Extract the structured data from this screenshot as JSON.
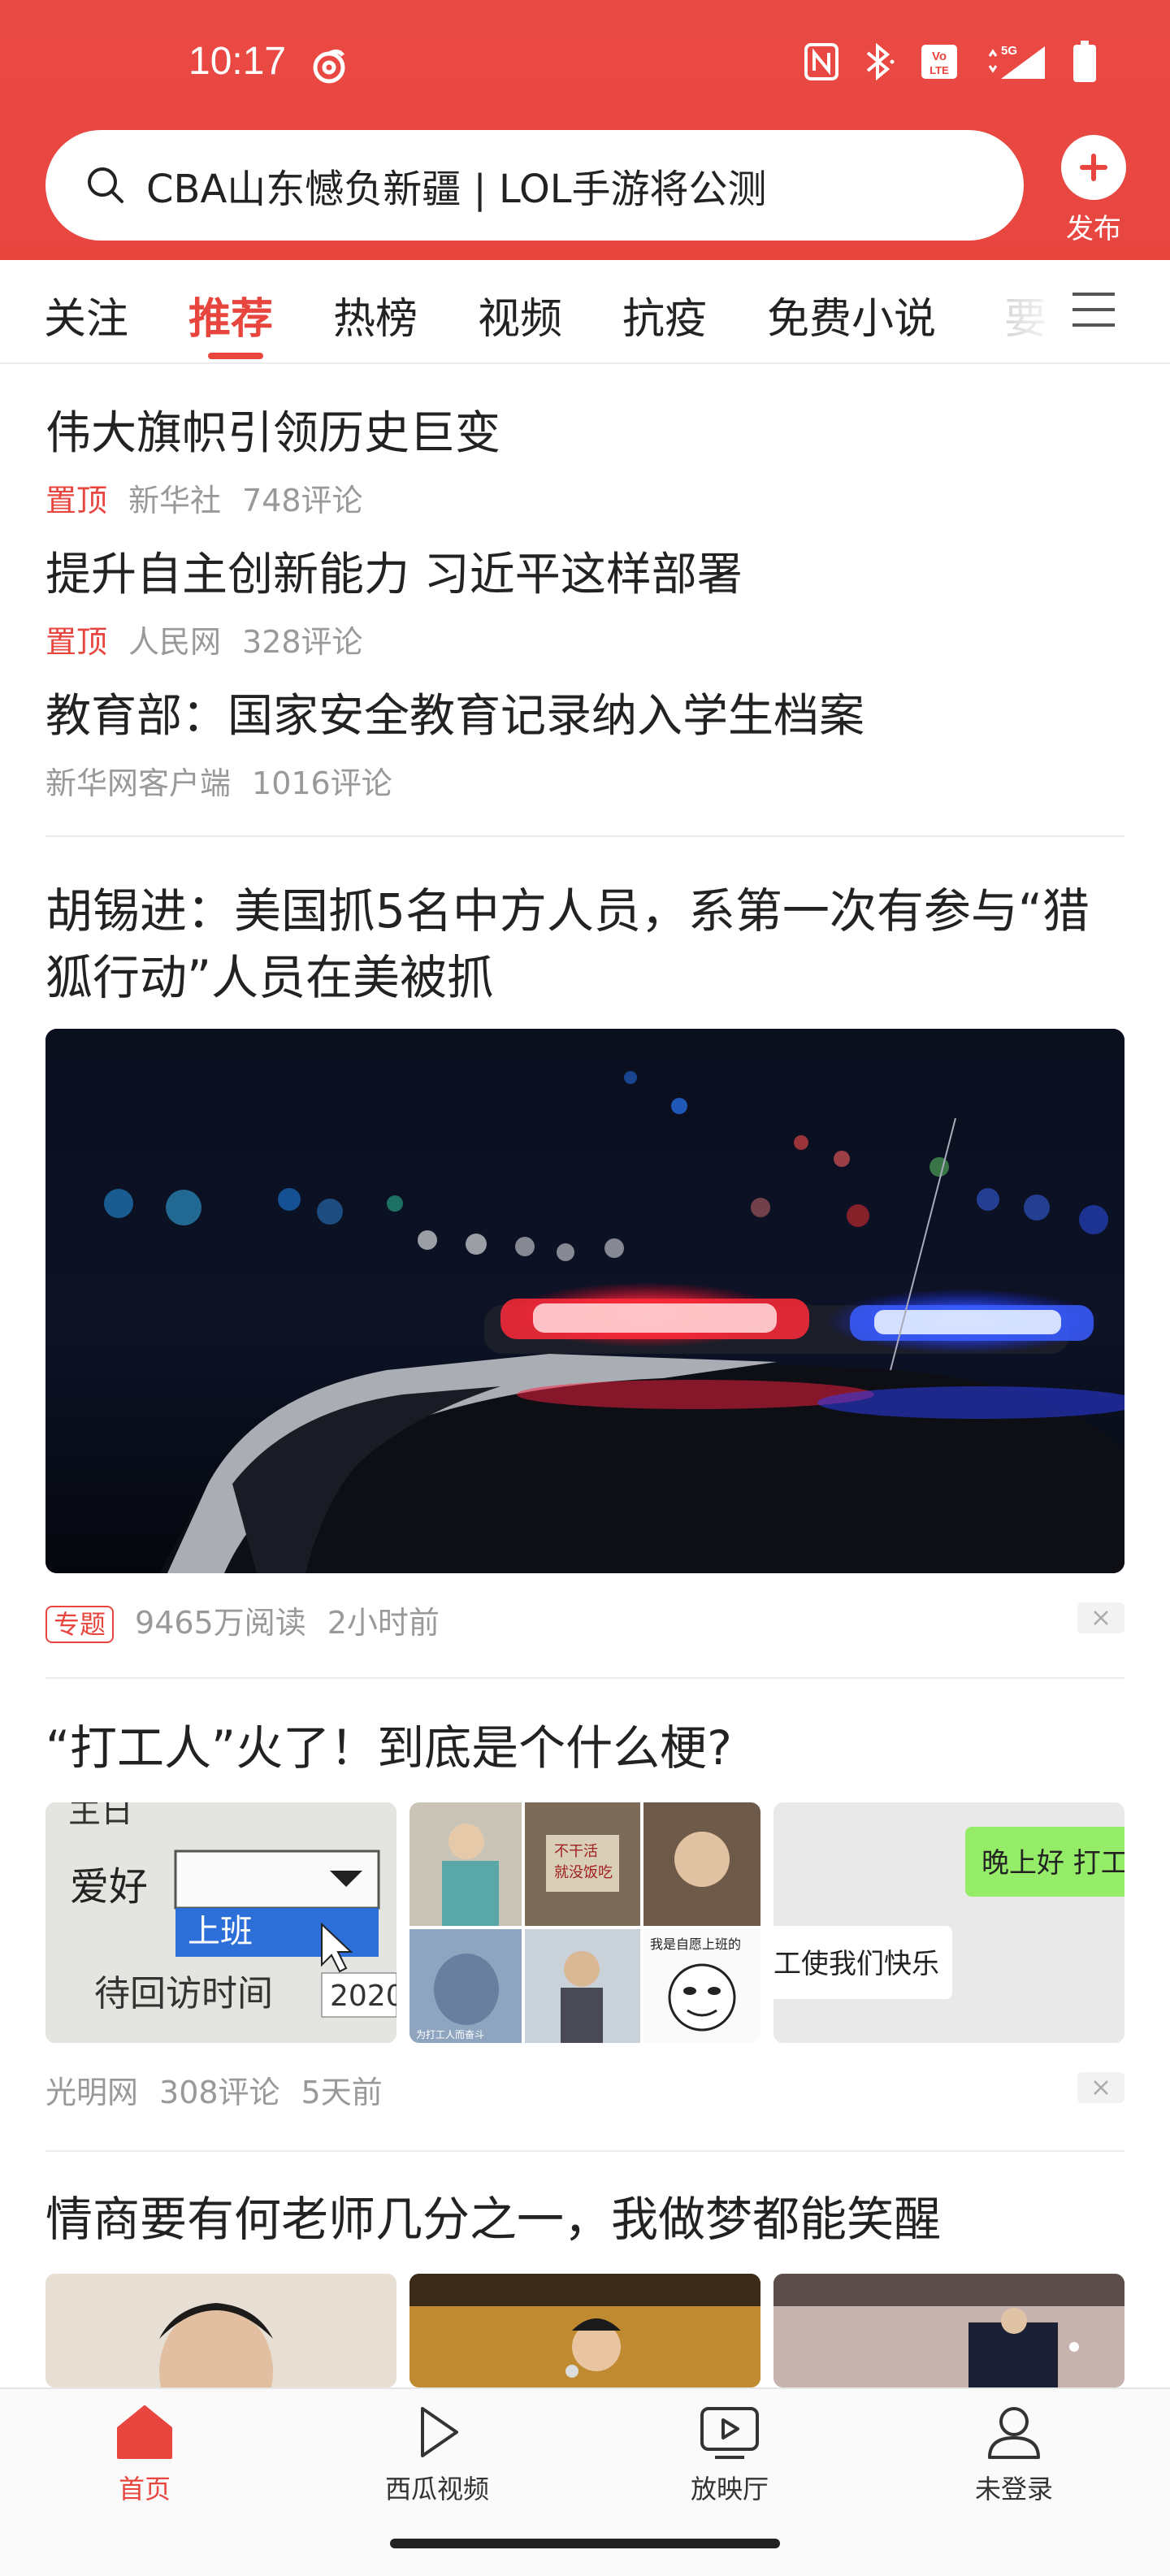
{
  "status_bar": {
    "time": "10:17",
    "icons": [
      "nfc-icon",
      "bluetooth-icon",
      "volte-icon",
      "5g-signal-icon",
      "battery-icon"
    ]
  },
  "search": {
    "placeholder": "CBA山东憾负新疆 | LOL手游将公测"
  },
  "publish": {
    "label": "发布"
  },
  "tabs": [
    {
      "label": "关注",
      "active": false
    },
    {
      "label": "推荐",
      "active": true
    },
    {
      "label": "热榜",
      "active": false
    },
    {
      "label": "视频",
      "active": false
    },
    {
      "label": "抗疫",
      "active": false
    },
    {
      "label": "免费小说",
      "active": false
    },
    {
      "label": "要",
      "active": false
    }
  ],
  "pinned": [
    {
      "title": "伟大旗帜引领历史巨变",
      "tag": "置顶",
      "source": "新华社",
      "comments": "748评论"
    },
    {
      "title": "提升自主创新能力 习近平这样部署",
      "tag": "置顶",
      "source": "人民网",
      "comments": "328评论"
    },
    {
      "title": "教育部：国家安全教育记录纳入学生档案",
      "tag": "",
      "source": "新华网客户端",
      "comments": "1016评论"
    }
  ],
  "article1": {
    "title_line1": "胡锡进：美国抓5名中方人员，系第一次有参与“猎",
    "title_line2": "狐行动”人员在美被抓",
    "badge": "专题",
    "reads": "9465万阅读",
    "time": "2小时前"
  },
  "article2": {
    "title": "“打工人”火了！到底是个什么梗?",
    "source": "光明网",
    "comments": "308评论",
    "time": "5天前",
    "thumb1_text": [
      "主日",
      "爱好",
      "上班",
      "待回访时间",
      "2020"
    ],
    "thumb2_captions": [
      "不干活",
      "就没饭吃",
      "我是自愿上班的",
      "为打工人而奋斗"
    ],
    "thumb3_text": [
      "晚上好 打工",
      "工使我们快乐"
    ]
  },
  "article3": {
    "title": "情商要有何老师几分之一，我做梦都能笑醒"
  },
  "bottom_nav": [
    {
      "label": "首页",
      "icon": "home-icon",
      "active": true
    },
    {
      "label": "西瓜视频",
      "icon": "play-icon",
      "active": false
    },
    {
      "label": "放映厅",
      "icon": "tv-play-icon",
      "active": false
    },
    {
      "label": "未登录",
      "icon": "user-icon",
      "active": false
    }
  ],
  "colors": {
    "accent": "#e8453f",
    "meta_gray": "#999999"
  }
}
